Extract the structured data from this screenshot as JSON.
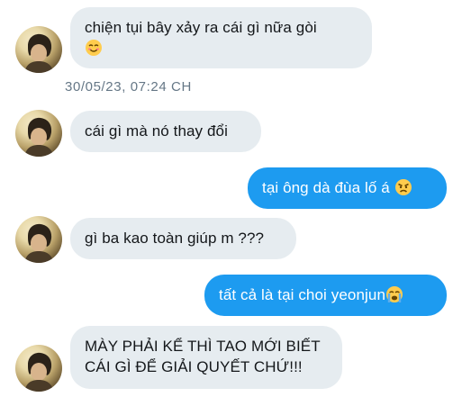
{
  "conversation": {
    "messages": [
      {
        "sender": "them",
        "text": "chiện tụi bây xảy ra cái gì nữa gòi",
        "emoji": "smiling-face-icon"
      },
      {
        "sender": "them",
        "text": "cái gì mà nó thay đổi"
      },
      {
        "sender": "me",
        "text": "tại ông dà đùa lố á",
        "emoji": "angry-face-icon"
      },
      {
        "sender": "them",
        "text": "gì ba kao toàn giúp m ???"
      },
      {
        "sender": "me",
        "text": "tất cả là tại choi yeonjun",
        "emoji": "crying-face-icon"
      },
      {
        "sender": "them",
        "text": "MÀY PHẢI KỂ THÌ TAO MỚI BIẾT CÁI GÌ ĐỂ GIẢI QUYẾT CHỨ!!!"
      }
    ],
    "timestamp": "30/05/23, 07:24 CH"
  },
  "colors": {
    "incoming_bubble": "#e6ecf0",
    "outgoing_bubble": "#1d9bf0",
    "timestamp_text": "#657786"
  }
}
